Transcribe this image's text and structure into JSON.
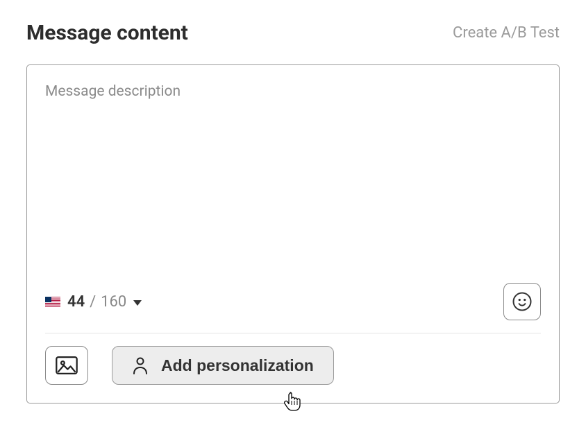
{
  "header": {
    "title": "Message content",
    "ab_test_label": "Create A/B Test"
  },
  "editor": {
    "placeholder": "Message description",
    "value": ""
  },
  "counter": {
    "current": "44",
    "separator": "/",
    "max": "160",
    "locale_flag": "us"
  },
  "toolbar": {
    "emoji_icon": "smile-icon",
    "image_icon": "image-icon",
    "personalization_icon": "person-icon",
    "personalization_label": "Add personalization"
  }
}
